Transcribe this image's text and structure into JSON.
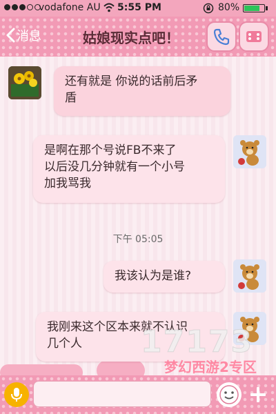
{
  "status_bar": {
    "carrier": "vodafone AU",
    "time": "5:55 PM",
    "battery_text": "80%",
    "battery_level": 0.8,
    "signal_bars": 3,
    "signal_total": 5
  },
  "nav": {
    "back_label": "消息",
    "title": "姑娘现实点吧！"
  },
  "messages": [
    {
      "side": "in",
      "text_lines": [
        "还有就是 你说的话前后矛",
        "盾"
      ],
      "avatar_icon": "flower-box-avatar"
    },
    {
      "side": "out",
      "text_lines": [
        "是啊在那个号说FB不来了",
        "以后没几分钟就有一个小号",
        "加我骂我"
      ],
      "avatar_icon": "bear-avatar"
    },
    {
      "side": "out",
      "text_lines": [
        "我该认为是谁?"
      ],
      "avatar_icon": "bear-avatar"
    },
    {
      "side": "out",
      "text_lines": [
        "我刚来这个区本来就不认识",
        "几个人"
      ],
      "avatar_icon": "bear-avatar"
    }
  ],
  "timestamp": "下午 05:05",
  "watermark": {
    "number": "17173",
    "subtitle": "梦幻西游2专区"
  },
  "input": {
    "placeholder": ""
  },
  "colors": {
    "nav_pink": "#f29ab5",
    "bubble_in": "#fbd3dd",
    "bubble_out": "#fde3ea",
    "mic_yellow": "#f7b200"
  }
}
